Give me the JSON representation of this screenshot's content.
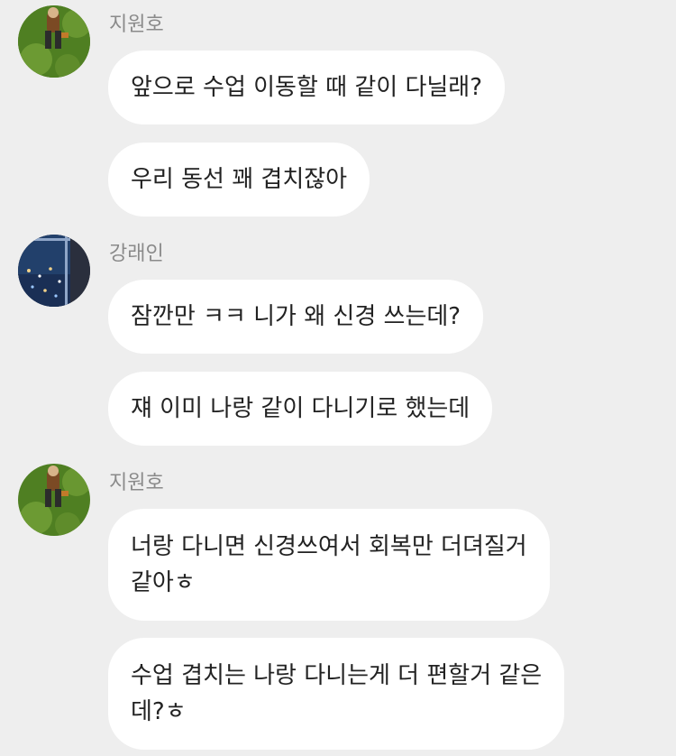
{
  "chat": {
    "messages": [
      {
        "sender": "지원호",
        "bubbles": [
          {
            "lines": [
              "앞으로 수업 이동할 때 같이 다닐래?"
            ]
          },
          {
            "lines": [
              "우리 동선 꽤 겹치잖아"
            ]
          }
        ]
      },
      {
        "sender": "강래인",
        "bubbles": [
          {
            "lines": [
              "잠깐만 ㅋㅋ 니가 왜 신경 쓰는데?"
            ]
          },
          {
            "lines": [
              "쟤 이미 나랑 같이 다니기로 했는데"
            ]
          }
        ]
      },
      {
        "sender": "지원호",
        "bubbles": [
          {
            "lines": [
              "너랑 다니면 신경쓰여서 회복만 더뎌질거",
              "같아ㅎ"
            ]
          },
          {
            "lines": [
              "수업 겹치는 나랑 다니는게 더 편할거 같은",
              "데?ㅎ"
            ]
          }
        ]
      }
    ]
  },
  "avatars": {
    "jiwonho": "green-grass-figure-avatar",
    "kangraein": "night-window-city-avatar"
  },
  "colors": {
    "background": "#eeeeee",
    "bubble": "#ffffff",
    "sender_text": "#8a8a8a",
    "message_text": "#222222"
  }
}
